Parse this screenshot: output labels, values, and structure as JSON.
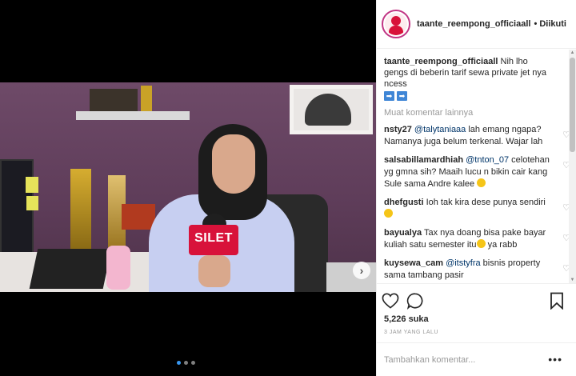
{
  "post": {
    "username": "taante_reempong_officiaall",
    "separator": "•",
    "follow_status": "Diikuti",
    "caption": "Nih lho gengs di beberin tarif sewa private jet nya ncess",
    "caption_arrows": [
      "➡",
      "➡"
    ],
    "load_more": "Muat komentar lainnya",
    "likes": "5,226 suka",
    "time_ago": "3 JAM YANG LALU",
    "add_comment_placeholder": "Tambahkan komentar...",
    "more_options": "•••"
  },
  "video": {
    "mic_label": "SILET",
    "next_icon": "›",
    "carousel_dots": 3,
    "active_dot": 0
  },
  "comments": [
    {
      "user": "nsty27",
      "mention": "@talytaniaaa",
      "text": " lah emang ngapa? Namanya juga belum terkenal. Wajar lah",
      "emoji": false
    },
    {
      "user": "salsabillamardhiah",
      "mention": "@tnton_07",
      "text": " celotehan yg gmna sih? Maaih lucu n bikin cair kang Sule sama Andre kalee",
      "emoji": true
    },
    {
      "user": "dhefgusti",
      "mention": "",
      "text": "Ioh tak kira dese punya sendiri",
      "emoji": true
    },
    {
      "user": "bayualya",
      "mention": "",
      "text": "Tax nya doang bisa pake bayar kuliah satu semester itu",
      "text_after": " ya rabb",
      "emoji": true
    },
    {
      "user": "kuysewa_cam",
      "mention": "@itstyfra",
      "text": " bisnis property sama tambang pasir",
      "emoji": false
    }
  ],
  "icons": {
    "heart": "heart-icon",
    "comment": "comment-icon",
    "bookmark": "bookmark-icon",
    "small_heart": "♡"
  },
  "colors": {
    "accent": "#3897f0",
    "mic_red": "#d8123a",
    "mention": "#003569"
  }
}
